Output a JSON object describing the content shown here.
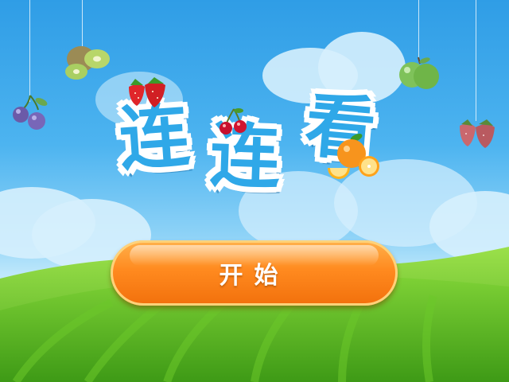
{
  "title": {
    "chars": [
      "连",
      "连",
      "看"
    ]
  },
  "start_button": {
    "label": "开始"
  },
  "decorations": {
    "fruit_icons": [
      "strawberry-icon",
      "cherry-icon",
      "orange-icon",
      "kiwi-icon",
      "apple-icon",
      "plum-icon"
    ]
  },
  "colors": {
    "sky_top": "#2f9de6",
    "title_blue": "#2fa8e8",
    "button_orange": "#ff8a1f",
    "grass_green": "#5cbf2a"
  }
}
